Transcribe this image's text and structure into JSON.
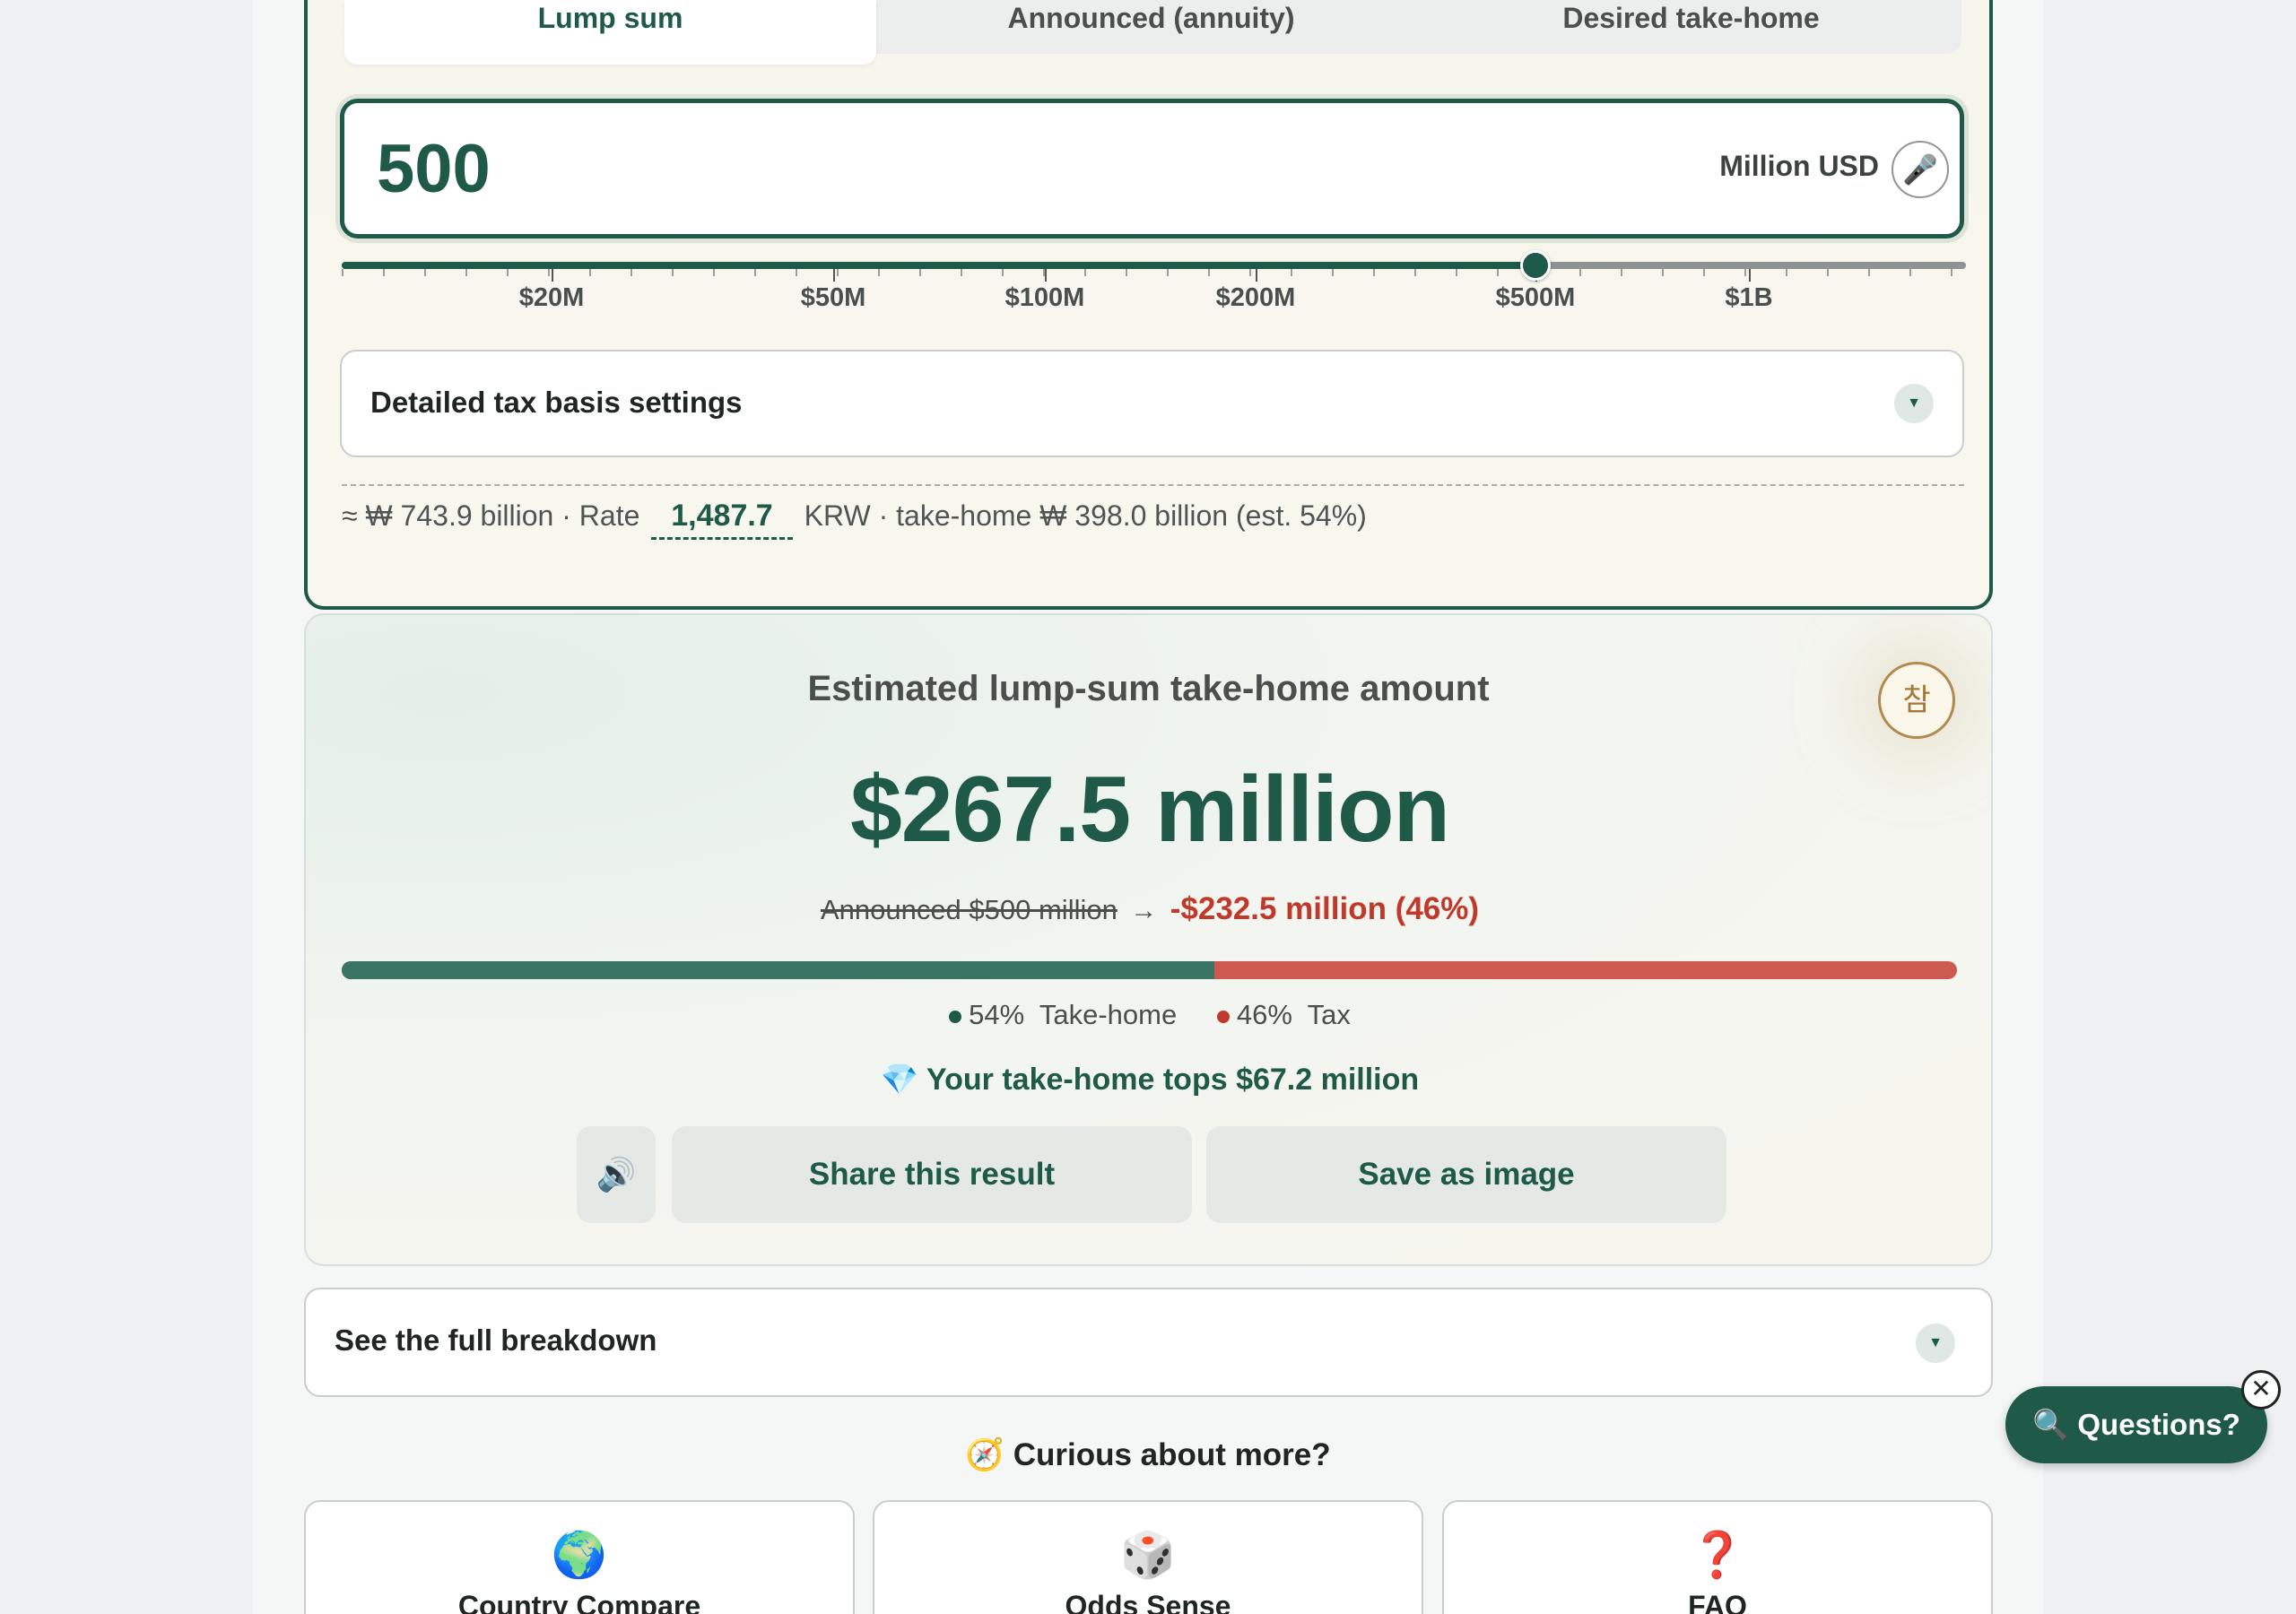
{
  "tabs": [
    {
      "label": "Lump sum",
      "active": true
    },
    {
      "label": "Announced (annuity)",
      "active": false
    },
    {
      "label": "Desired take-home",
      "active": false
    }
  ],
  "amount_input": {
    "value": "500",
    "unit": "Million USD",
    "mic_icon": "🎤"
  },
  "slider": {
    "value_label": "$500M",
    "labels": [
      "$20M",
      "$50M",
      "$100M",
      "$200M",
      "$500M",
      "$1B"
    ]
  },
  "tax_settings": {
    "label": "Detailed tax basis settings"
  },
  "conversion": {
    "prefix": "≈ ₩ 743.9 billion · Rate",
    "rate": "1,487.7",
    "suffix": "KRW · take-home ₩ 398.0 billion (est. 54%)"
  },
  "result": {
    "title": "Estimated lump-sum take-home amount",
    "badge": "참",
    "amount": "$267.5 million",
    "announced": "Announced $500 million",
    "arrow": "→",
    "difference": "-$232.5 million (46%)",
    "take_home_fraction": 0.54,
    "legend": {
      "take_pct": "54%",
      "take_label": "Take-home",
      "tax_pct": "46%",
      "tax_label": "Tax"
    },
    "milestone": "💎 Your take-home tops $67.2 million",
    "sound_icon": "🔊",
    "share_label": "Share this result",
    "save_label": "Save as image"
  },
  "breakdown": {
    "label": "See the full breakdown"
  },
  "more": {
    "title": "🧭 Curious about more?",
    "cards": [
      {
        "icon": "🌍",
        "label": "Country Compare"
      },
      {
        "icon": "🎲",
        "label": "Odds Sense"
      },
      {
        "icon": "❓",
        "label": "FAQ"
      }
    ]
  },
  "fab": {
    "label": "🔍 Questions?",
    "close": "✕"
  },
  "colors": {
    "brand": "#1e5a47",
    "tax": "#cd5a50",
    "take_home": "#3a7462"
  }
}
